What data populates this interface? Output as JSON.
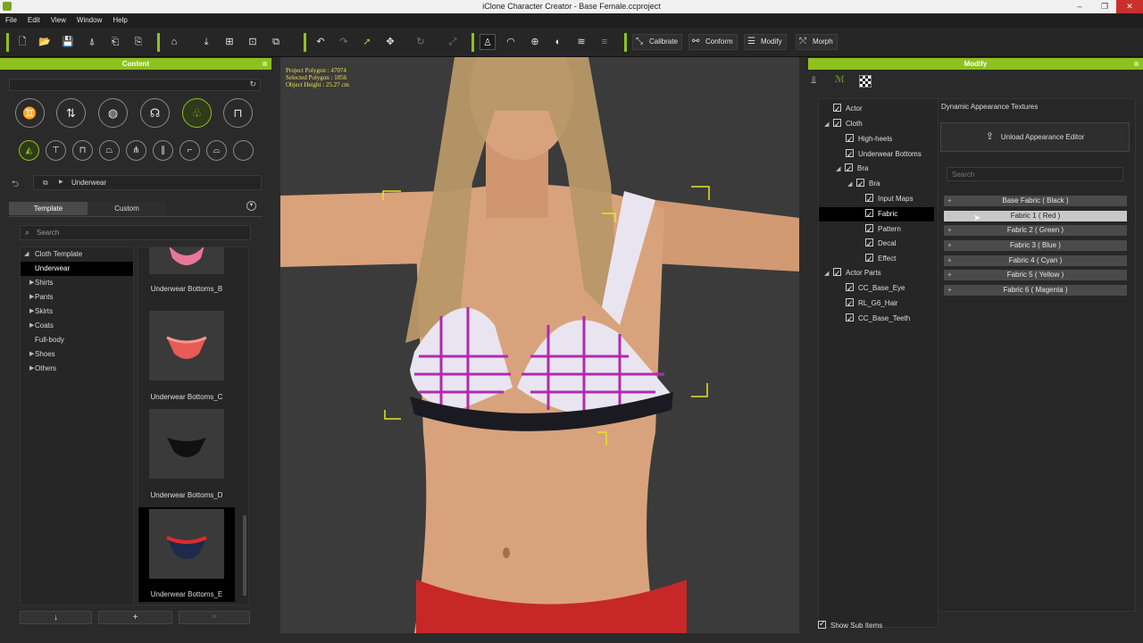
{
  "window": {
    "title": "iClone Character Creator - Base Female.ccproject",
    "controls": [
      "–",
      "❐",
      "✕"
    ]
  },
  "menu": [
    "File",
    "Edit",
    "View",
    "Window",
    "Help"
  ],
  "toolbar": {
    "calibrate": "Calibrate",
    "conform": "Conform",
    "modify": "Modify",
    "morph": "Morph"
  },
  "content_panel": {
    "title": "Content",
    "breadcrumb": "Underwear",
    "tabs": [
      "Template",
      "Custom"
    ],
    "search_placeholder": "Search",
    "tree": [
      {
        "label": "Cloth Template",
        "arrow": "◢",
        "selected": false
      },
      {
        "label": "Underwear",
        "arrow": "",
        "selected": true
      },
      {
        "label": "Shirts",
        "arrow": "▶",
        "selected": false
      },
      {
        "label": "Pants",
        "arrow": "▶",
        "selected": false
      },
      {
        "label": "Skirts",
        "arrow": "▶",
        "selected": false
      },
      {
        "label": "Coats",
        "arrow": "▶",
        "selected": false
      },
      {
        "label": "Full-body",
        "arrow": "",
        "selected": false
      },
      {
        "label": "Shoes",
        "arrow": "▶",
        "selected": false
      },
      {
        "label": "Others",
        "arrow": "▶",
        "selected": false
      }
    ],
    "items": [
      "Underwear Bottoms_B",
      "Underwear Bottoms_C",
      "Underwear Bottoms_D",
      "Underwear Bottoms_E"
    ]
  },
  "viewport": {
    "polygon": "Project Polygon : 47074",
    "selected": "Selected Polygon : 1056",
    "height": "Object Height : 25.27 cm"
  },
  "modify_panel": {
    "title": "Modify",
    "section": "Dynamic Appearance Textures",
    "unload_button": "Unload Appearance Editor",
    "search_placeholder": "Search",
    "tree": [
      {
        "label": "Actor",
        "indent": 0,
        "arrow": ""
      },
      {
        "label": "Cloth",
        "indent": 0,
        "arrow": "◢"
      },
      {
        "label": "High-heels",
        "indent": 1,
        "arrow": ""
      },
      {
        "label": "Underwear Bottoms",
        "indent": 1,
        "arrow": ""
      },
      {
        "label": "Bra",
        "indent": 1,
        "arrow": "◢"
      },
      {
        "label": "Bra",
        "indent": 2,
        "arrow": "◢"
      },
      {
        "label": "Input Maps",
        "indent": 3,
        "arrow": ""
      },
      {
        "label": "Fabric",
        "indent": 3,
        "arrow": "",
        "selected": true
      },
      {
        "label": "Pattern",
        "indent": 3,
        "arrow": ""
      },
      {
        "label": "Decal",
        "indent": 3,
        "arrow": ""
      },
      {
        "label": "Effect",
        "indent": 3,
        "arrow": ""
      },
      {
        "label": "Actor Parts",
        "indent": 0,
        "arrow": "◢"
      },
      {
        "label": "CC_Base_Eye",
        "indent": 1,
        "arrow": ""
      },
      {
        "label": "RL_G6_Hair",
        "indent": 1,
        "arrow": ""
      },
      {
        "label": "CC_Base_Teeth",
        "indent": 1,
        "arrow": ""
      }
    ],
    "fabrics": [
      "Base Fabric ( Black )",
      "Fabric 1 ( Red )",
      "Fabric 2 ( Green )",
      "Fabric 3 ( Blue )",
      "Fabric 4 ( Cyan )",
      "Fabric 5 ( Yellow )",
      "Fabric 6 ( Magenta )"
    ],
    "show_sub_items": "Show Sub Items"
  },
  "colors": {
    "accent": "#8dc21f"
  }
}
